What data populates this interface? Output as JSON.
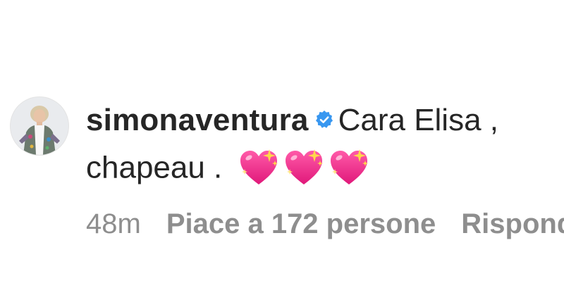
{
  "comment": {
    "avatar_icon": "profile-photo",
    "username": "simonaventura",
    "verified_icon": "verified-badge-icon",
    "verified_color": "#3897f0",
    "text_line1": "Cara Elisa ,",
    "text_line2": "chapeau .",
    "emoji": [
      "sparkling-heart-icon",
      "sparkling-heart-icon",
      "sparkling-heart-icon"
    ],
    "heart_color": "#f0308c"
  },
  "meta": {
    "time": "48m",
    "likes": "Piace a 172 persone",
    "reply": "Rispondi"
  }
}
